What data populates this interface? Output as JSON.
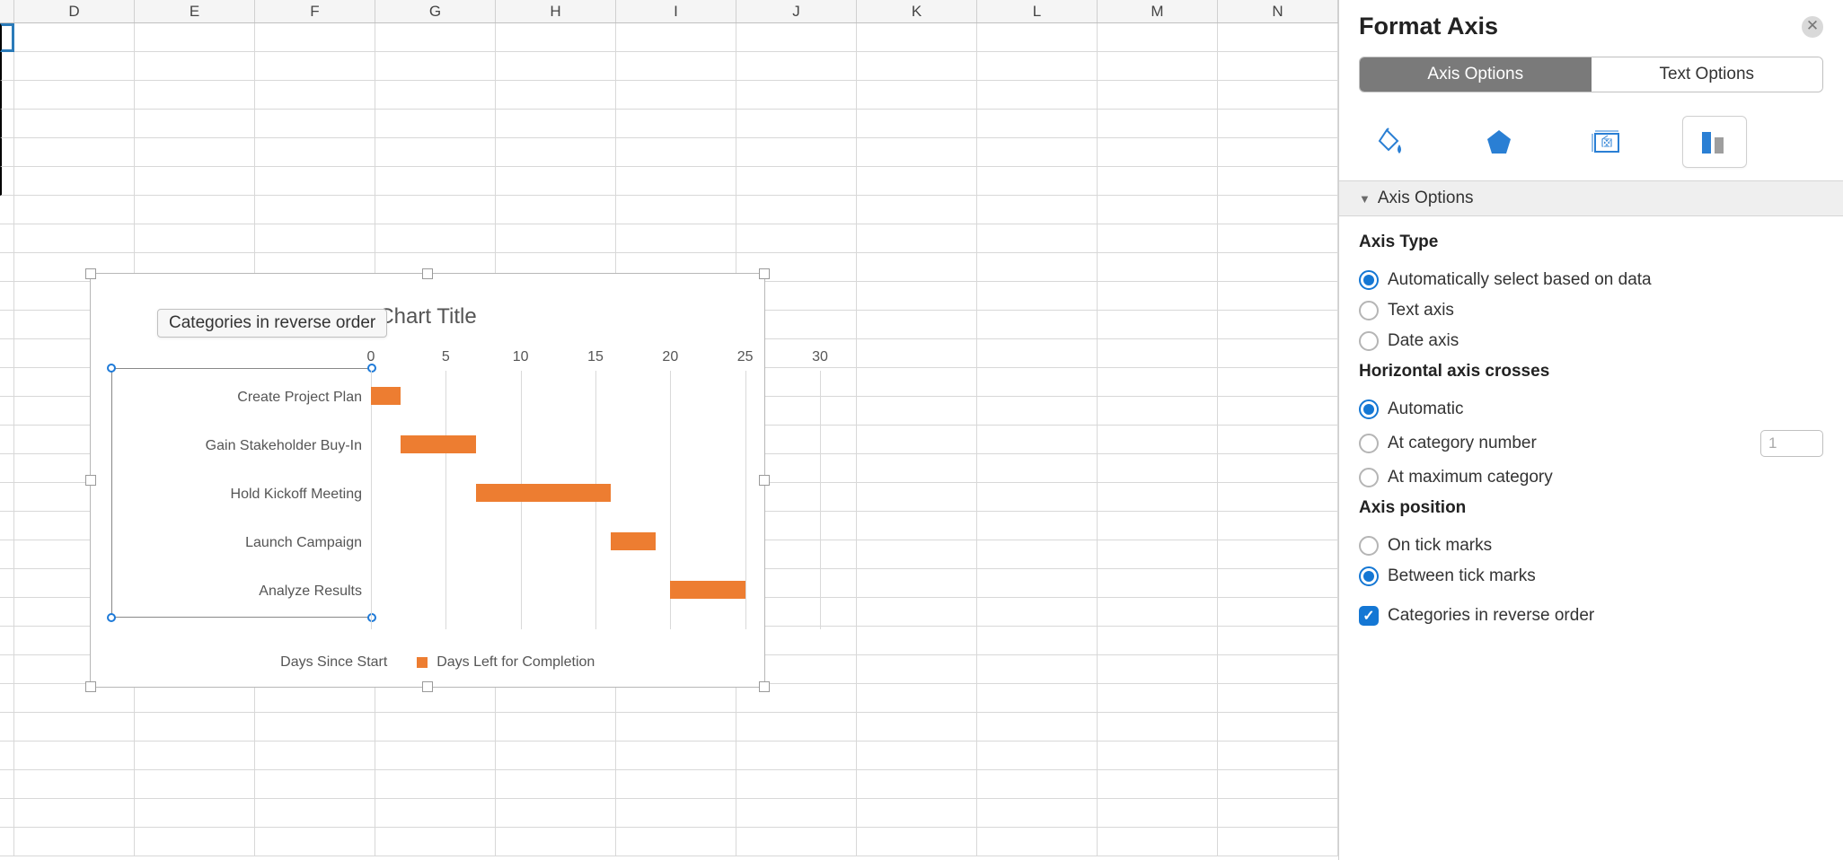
{
  "columns": [
    "D",
    "E",
    "F",
    "G",
    "H",
    "I",
    "J",
    "K",
    "L",
    "M",
    "N"
  ],
  "panel": {
    "title": "Format Axis",
    "segmented": {
      "axis_options": "Axis Options",
      "text_options": "Text Options"
    },
    "section_header": "Axis Options",
    "axis_type": {
      "title": "Axis Type",
      "auto": "Automatically select based on data",
      "text": "Text axis",
      "date": "Date axis"
    },
    "horiz_crosses": {
      "title": "Horizontal axis crosses",
      "automatic": "Automatic",
      "at_category": "At category number",
      "at_category_value": "1",
      "at_max": "At maximum category"
    },
    "axis_position": {
      "title": "Axis position",
      "on_tick": "On tick marks",
      "between_tick": "Between tick marks",
      "reverse": "Categories in reverse order"
    }
  },
  "tooltip": "Categories in reverse order",
  "chart_data": {
    "type": "bar",
    "title": "Chart Title",
    "x_ticks": [
      0,
      5,
      10,
      15,
      20,
      25,
      30
    ],
    "categories": [
      "Create Project Plan",
      "Gain Stakeholder Buy-In",
      "Hold Kickoff Meeting",
      "Launch Campaign",
      "Analyze Results"
    ],
    "series": [
      {
        "name": "Days Since Start",
        "values": [
          0,
          2,
          7,
          16,
          20
        ],
        "color_hidden": true
      },
      {
        "name": "Days Left for Completion",
        "values": [
          2,
          5,
          9,
          3,
          5
        ],
        "color": "#ed7d31"
      }
    ],
    "xlim": [
      0,
      30
    ],
    "legend": [
      "Days Since Start",
      "Days Left for Completion"
    ],
    "orientation": "horizontal",
    "stacked": true
  }
}
